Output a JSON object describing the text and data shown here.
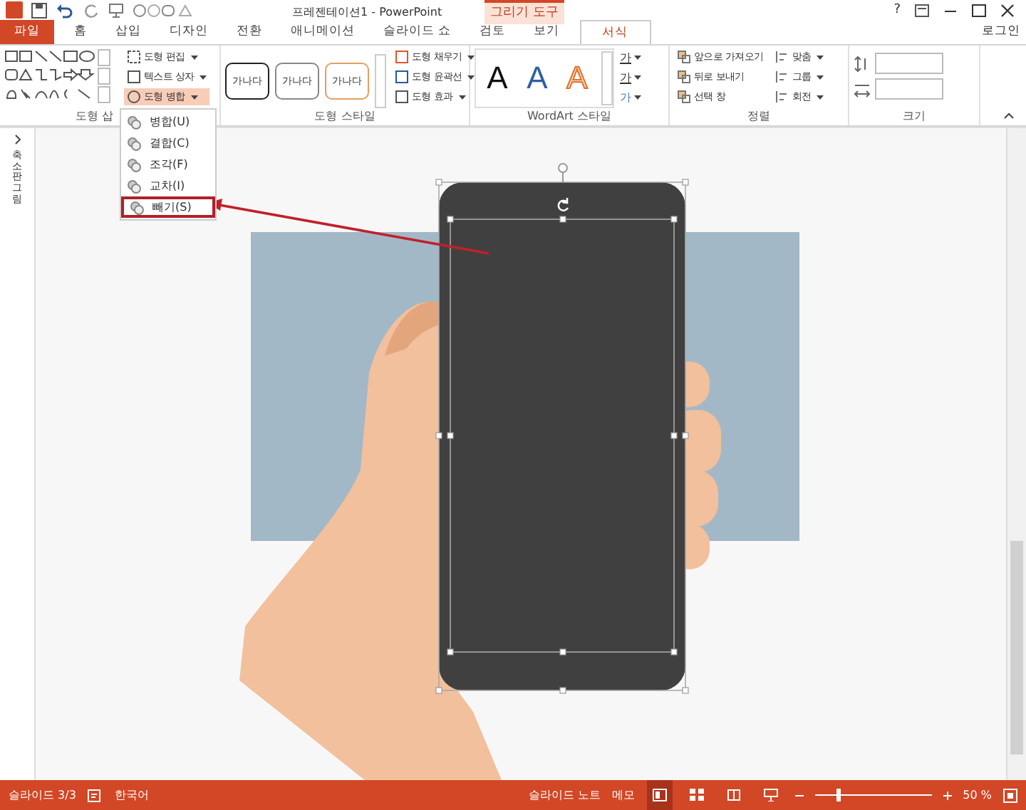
{
  "window": {
    "title": "프레젠테이션1 - PowerPoint",
    "context_tab": "그리기 도구"
  },
  "tabs": [
    {
      "label": "파일",
      "kind": "file",
      "selected": false
    },
    {
      "label": "홈",
      "kind": "tab",
      "selected": false
    },
    {
      "label": "삽입",
      "kind": "tab",
      "selected": false
    },
    {
      "label": "디자인",
      "kind": "tab",
      "selected": false
    },
    {
      "label": "전환",
      "kind": "tab",
      "selected": false
    },
    {
      "label": "애니메이션",
      "kind": "tab",
      "selected": false
    },
    {
      "label": "슬라이드 쇼",
      "kind": "tab",
      "selected": false
    },
    {
      "label": "검토",
      "kind": "tab",
      "selected": false
    },
    {
      "label": "보기",
      "kind": "tab",
      "selected": false
    },
    {
      "label": "서식",
      "kind": "tab",
      "selected": true
    }
  ],
  "sign_in": "로그인",
  "ribbon": {
    "insert_shapes": {
      "label": "도형 삽",
      "commands": [
        {
          "label": "도형 편집",
          "expanded": false
        },
        {
          "label": "텍스트 상자",
          "expanded": false
        },
        {
          "label": "도형 병합",
          "expanded": true
        }
      ]
    },
    "shape_styles": {
      "label": "도형 스타일",
      "presets": [
        "가나다",
        "가나다",
        "가나다"
      ],
      "commands": [
        "도형 채우기",
        "도형 윤곽선",
        "도형 효과"
      ]
    },
    "wordart_styles": {
      "label": "WordArt 스타일",
      "samples": [
        "A",
        "A",
        "A"
      ],
      "text_tools": [
        "가",
        "가",
        "가"
      ]
    },
    "arrange": {
      "label": "정렬",
      "commands": [
        "앞으로 가져오기",
        "뒤로 보내기",
        "선택 창"
      ],
      "align": [
        "맞춤",
        "그룹",
        "회전"
      ]
    },
    "size": {
      "label": "크기"
    }
  },
  "merge_menu": [
    {
      "label": "병합(U)",
      "selected": false
    },
    {
      "label": "결합(C)",
      "selected": false
    },
    {
      "label": "조각(F)",
      "selected": false
    },
    {
      "label": "교차(I)",
      "selected": false
    },
    {
      "label": "빼기(S)",
      "selected": true
    }
  ],
  "thumbnails_pane": {
    "label": "축소판그림"
  },
  "status_bar": {
    "slide": "슬라이드 3/3",
    "language": "한국어",
    "notes": "슬라이드 노트",
    "comments": "메모",
    "zoom": "50 %",
    "zoom_slider": {
      "level": 0.2
    }
  },
  "window_controls": {
    "help": "?"
  }
}
